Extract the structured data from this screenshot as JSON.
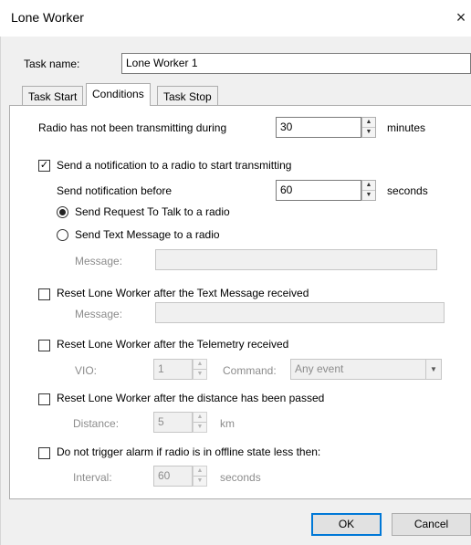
{
  "window": {
    "title": "Lone Worker",
    "close_icon": "×"
  },
  "task_name": {
    "label": "Task name:",
    "value": "Lone Worker 1"
  },
  "tabs": [
    {
      "label": "Task Start"
    },
    {
      "label": "Conditions",
      "active": true
    },
    {
      "label": "Task Stop"
    }
  ],
  "conditions": {
    "not_transmitting": {
      "label": "Radio has not been transmitting during",
      "value": "30",
      "unit": "minutes"
    },
    "send_notification": {
      "checked": true,
      "label": "Send a notification to a radio to start transmitting"
    },
    "notify_before": {
      "label": "Send notification before",
      "value": "60",
      "unit": "seconds"
    },
    "radio_request": {
      "selected": true,
      "label": "Send Request To Talk to a radio"
    },
    "radio_text": {
      "selected": false,
      "label": "Send Text Message to a radio"
    },
    "message1": {
      "label": "Message:",
      "value": ""
    },
    "reset_text": {
      "checked": false,
      "label": "Reset Lone Worker after the Text Message received"
    },
    "message2": {
      "label": "Message:",
      "value": ""
    },
    "reset_telemetry": {
      "checked": false,
      "label": "Reset Lone Worker after the Telemetry received"
    },
    "vio": {
      "label": "VIO:",
      "value": "1"
    },
    "command": {
      "label": "Command:",
      "value": "Any event"
    },
    "reset_distance": {
      "checked": false,
      "label": "Reset Lone Worker after the distance has been passed"
    },
    "distance": {
      "label": "Distance:",
      "value": "5",
      "unit": "km"
    },
    "offline": {
      "checked": false,
      "label": "Do not trigger alarm if radio is in offline state less then:"
    },
    "interval": {
      "label": "Interval:",
      "value": "60",
      "unit": "seconds"
    }
  },
  "buttons": {
    "ok": "OK",
    "cancel": "Cancel"
  },
  "icons": {
    "check": "✓",
    "spin_up": "▲",
    "spin_down": "▼",
    "dropdown": "▼"
  },
  "colors": {
    "accent": "#0078d7",
    "disabled_text": "#8c8c8c"
  }
}
